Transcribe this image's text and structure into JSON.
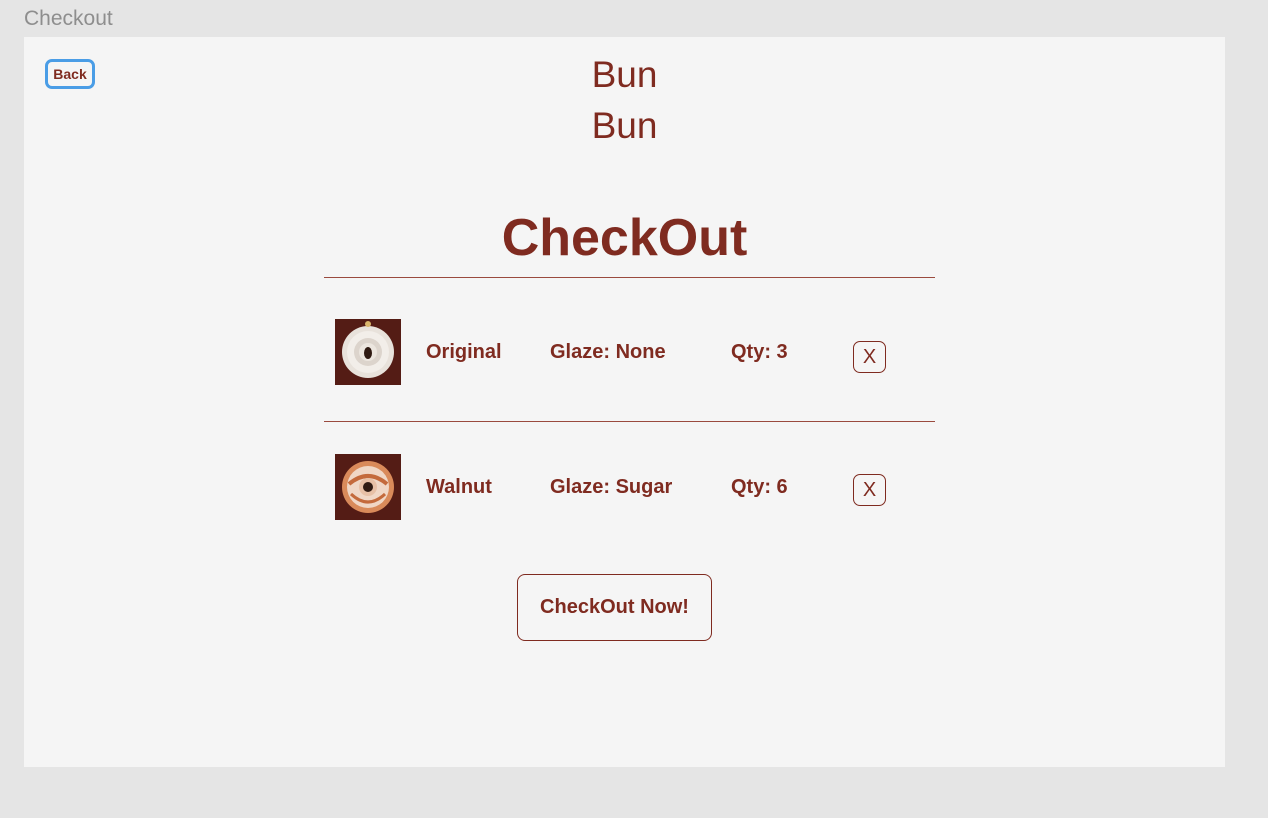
{
  "frame": {
    "label": "Checkout"
  },
  "header": {
    "back_label": "Back",
    "logo_line1": "Bun",
    "logo_line2": "Bun"
  },
  "page": {
    "title": "CheckOut"
  },
  "cart": {
    "items": [
      {
        "name": "Original",
        "glaze": "Glaze: None",
        "qty": "Qty: 3",
        "remove_label": "X",
        "thumb_icon": "original-cinnamon-roll-image"
      },
      {
        "name": "Walnut",
        "glaze": "Glaze: Sugar",
        "qty": "Qty: 6",
        "remove_label": "X",
        "thumb_icon": "walnut-cinnamon-roll-image"
      }
    ]
  },
  "footer": {
    "checkout_label": "CheckOut Now!"
  },
  "colors": {
    "brand": "#7f2b20",
    "focus_ring": "#4a9de6",
    "background": "#f5f5f5"
  }
}
